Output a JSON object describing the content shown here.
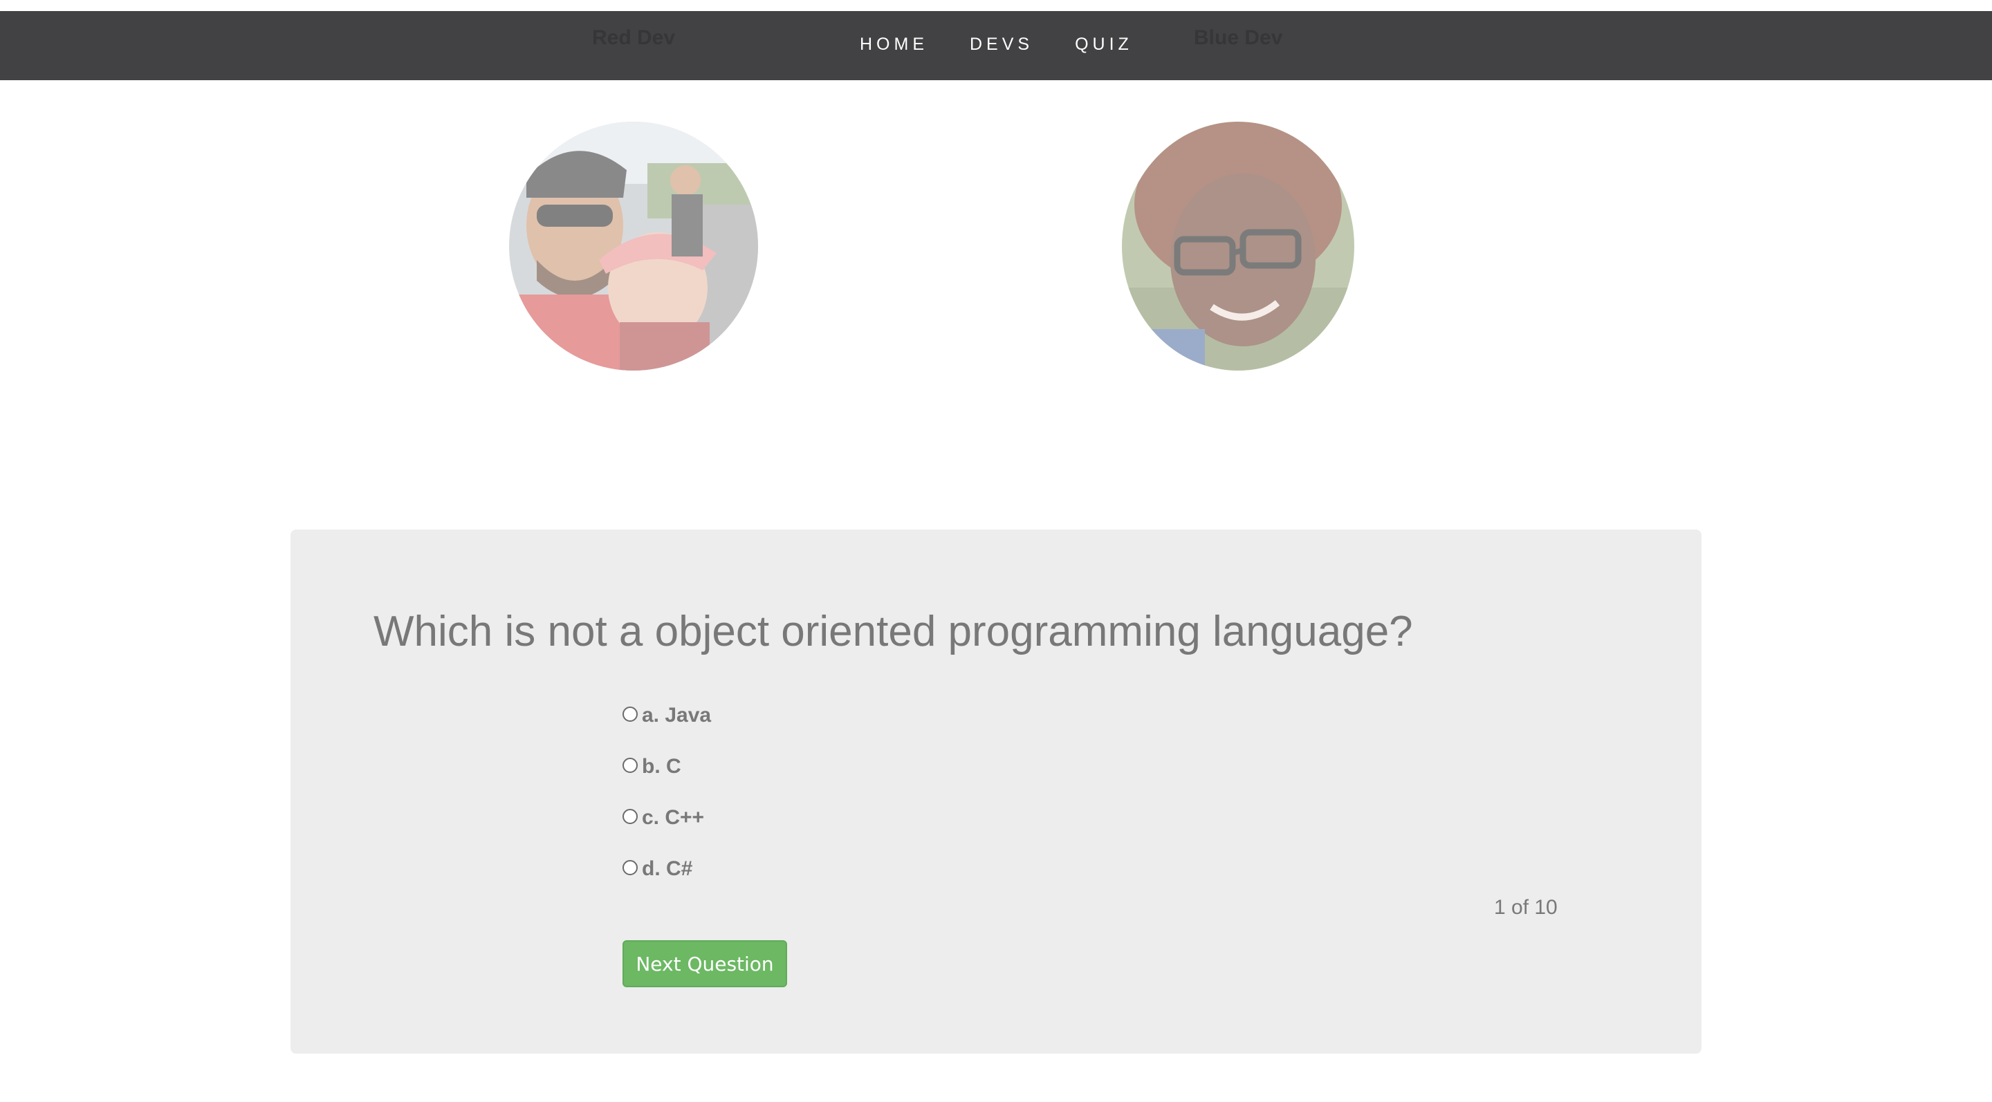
{
  "nav": {
    "red_dev": "Red Dev",
    "home": "HOME",
    "devs": "DEVS",
    "quiz": "QUIZ",
    "blue_dev": "Blue Dev"
  },
  "colors": {
    "navbar": "#424244",
    "card": "#ededed",
    "button": "#6cb863",
    "text": "#787878"
  },
  "quiz": {
    "question": "Which is not a object oriented programming language?",
    "options": [
      "a. Java",
      "b. C",
      "c. C++",
      "d. C#"
    ],
    "counter": "1 of 10",
    "next_button": "Next Question"
  }
}
